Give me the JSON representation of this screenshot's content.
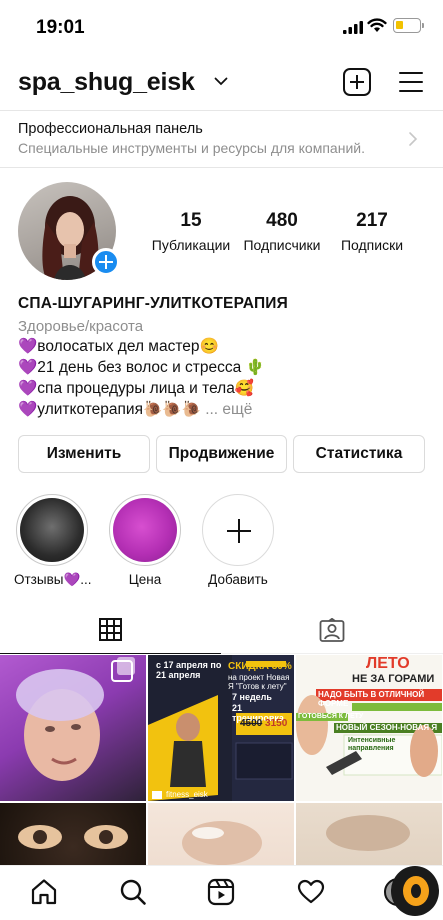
{
  "status_bar": {
    "time": "19:01"
  },
  "header": {
    "username": "spa_shug_eisk"
  },
  "pro_panel": {
    "title": "Профессиональная панель",
    "subtitle": "Специальные инструменты и ресурсы для компаний."
  },
  "stats": [
    {
      "value": "15",
      "label": "Публикации"
    },
    {
      "value": "480",
      "label": "Подписчики"
    },
    {
      "value": "217",
      "label": "Подписки"
    }
  ],
  "bio": {
    "name": "СПА-ШУГАРИНГ-УЛИТКОТЕРАПИЯ",
    "category": "Здоровье/красота",
    "lines": [
      "💜волосатых дел мастер😊",
      "💜21 день без волос и стресса 🌵",
      "💜спа процедуры лица и тела🥰",
      "💜улиткотерапия🐌🐌🐌"
    ],
    "more": "... ещё"
  },
  "buttons": {
    "edit": "Изменить",
    "promote": "Продвижение",
    "stats": "Статистика"
  },
  "highlights": [
    {
      "label": "Отзывы💜..."
    },
    {
      "label": "Цена"
    },
    {
      "label": "Добавить"
    }
  ],
  "grid": {
    "post2": {
      "dates": "с 17 апреля по 21 апреля",
      "headline": "СКИДКА 30%",
      "sub": "на проект Новая Я \"Готов к лету\"",
      "weeks": "7 недель",
      "trainings": "21 тренировка",
      "old_price": "4500",
      "new_price": "3150",
      "handle": "fitness_eisk"
    },
    "post3": {
      "line1": "ЛЕТО",
      "line2": "НЕ ЗА ГОРАМИ",
      "line3": "НАДО БЫТЬ В ОТЛИЧНОЙ ФОРМЕ",
      "line4": "ГОТОВЬСЯ К ЛЕТУ",
      "line5": "НОВЫЙ СЕЗОН-НОВАЯ Я",
      "line6": "Интенсивные направления"
    }
  },
  "colors": {
    "accent_blue": "#1a8cf0",
    "muted_text": "#8e8e8e",
    "border": "#dbdbdb"
  }
}
